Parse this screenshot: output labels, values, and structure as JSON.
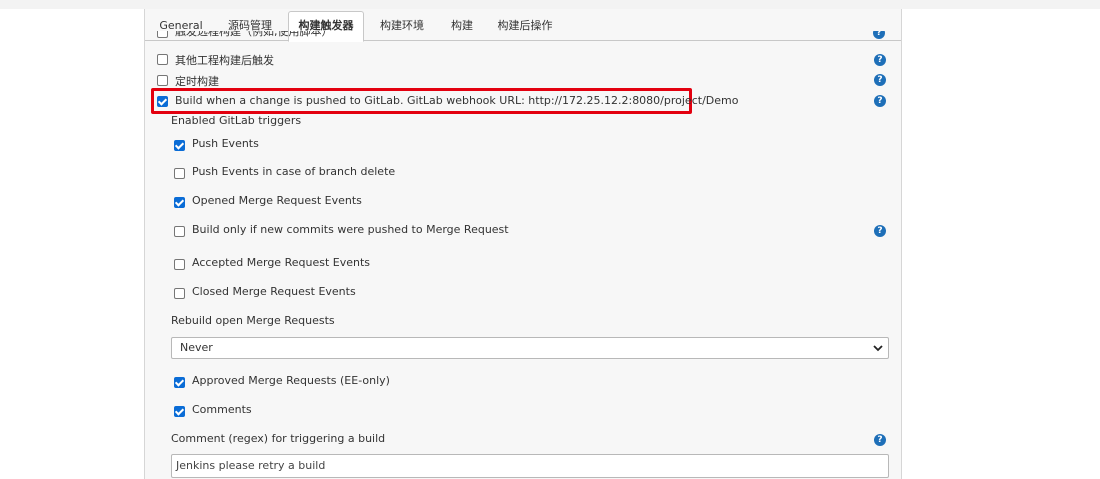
{
  "tabs": [
    {
      "label": "General"
    },
    {
      "label": "源码管理"
    },
    {
      "label": "构建触发器"
    },
    {
      "label": "构建环境"
    },
    {
      "label": "构建"
    },
    {
      "label": "构建后操作"
    }
  ],
  "active_tab": "构建触发器",
  "triggers": {
    "cut_off_label": "触发远程构建（例如,使用脚本）",
    "other_project_label": "其他工程构建后触发",
    "scheduled_label": "定时构建",
    "gitlab_label": "Build when a change is pushed to GitLab. GitLab webhook URL: http://172.25.12.2:8080/project/Demo"
  },
  "gitlab": {
    "section_title": "Enabled GitLab triggers",
    "push_events": {
      "label": "Push Events",
      "checked": true
    },
    "push_delete": {
      "label": "Push Events in case of branch delete",
      "checked": false
    },
    "opened_mr": {
      "label": "Opened Merge Request Events",
      "checked": true
    },
    "new_commits_mr": {
      "label": "Build only if new commits were pushed to Merge Request",
      "checked": false
    },
    "accepted_mr": {
      "label": "Accepted Merge Request Events",
      "checked": false
    },
    "closed_mr": {
      "label": "Closed Merge Request Events",
      "checked": false
    },
    "rebuild_title": "Rebuild open Merge Requests",
    "rebuild_value": "Never",
    "approved_mr": {
      "label": "Approved Merge Requests (EE-only)",
      "checked": true
    },
    "comments": {
      "label": "Comments",
      "checked": true
    },
    "comment_regex_title": "Comment (regex) for triggering a build",
    "comment_regex_value": "Jenkins please retry a build"
  },
  "help_glyph": "?",
  "colors": {
    "accent": "#0a6cd6",
    "help": "#1e6fb8",
    "highlight": "#e3000f"
  }
}
